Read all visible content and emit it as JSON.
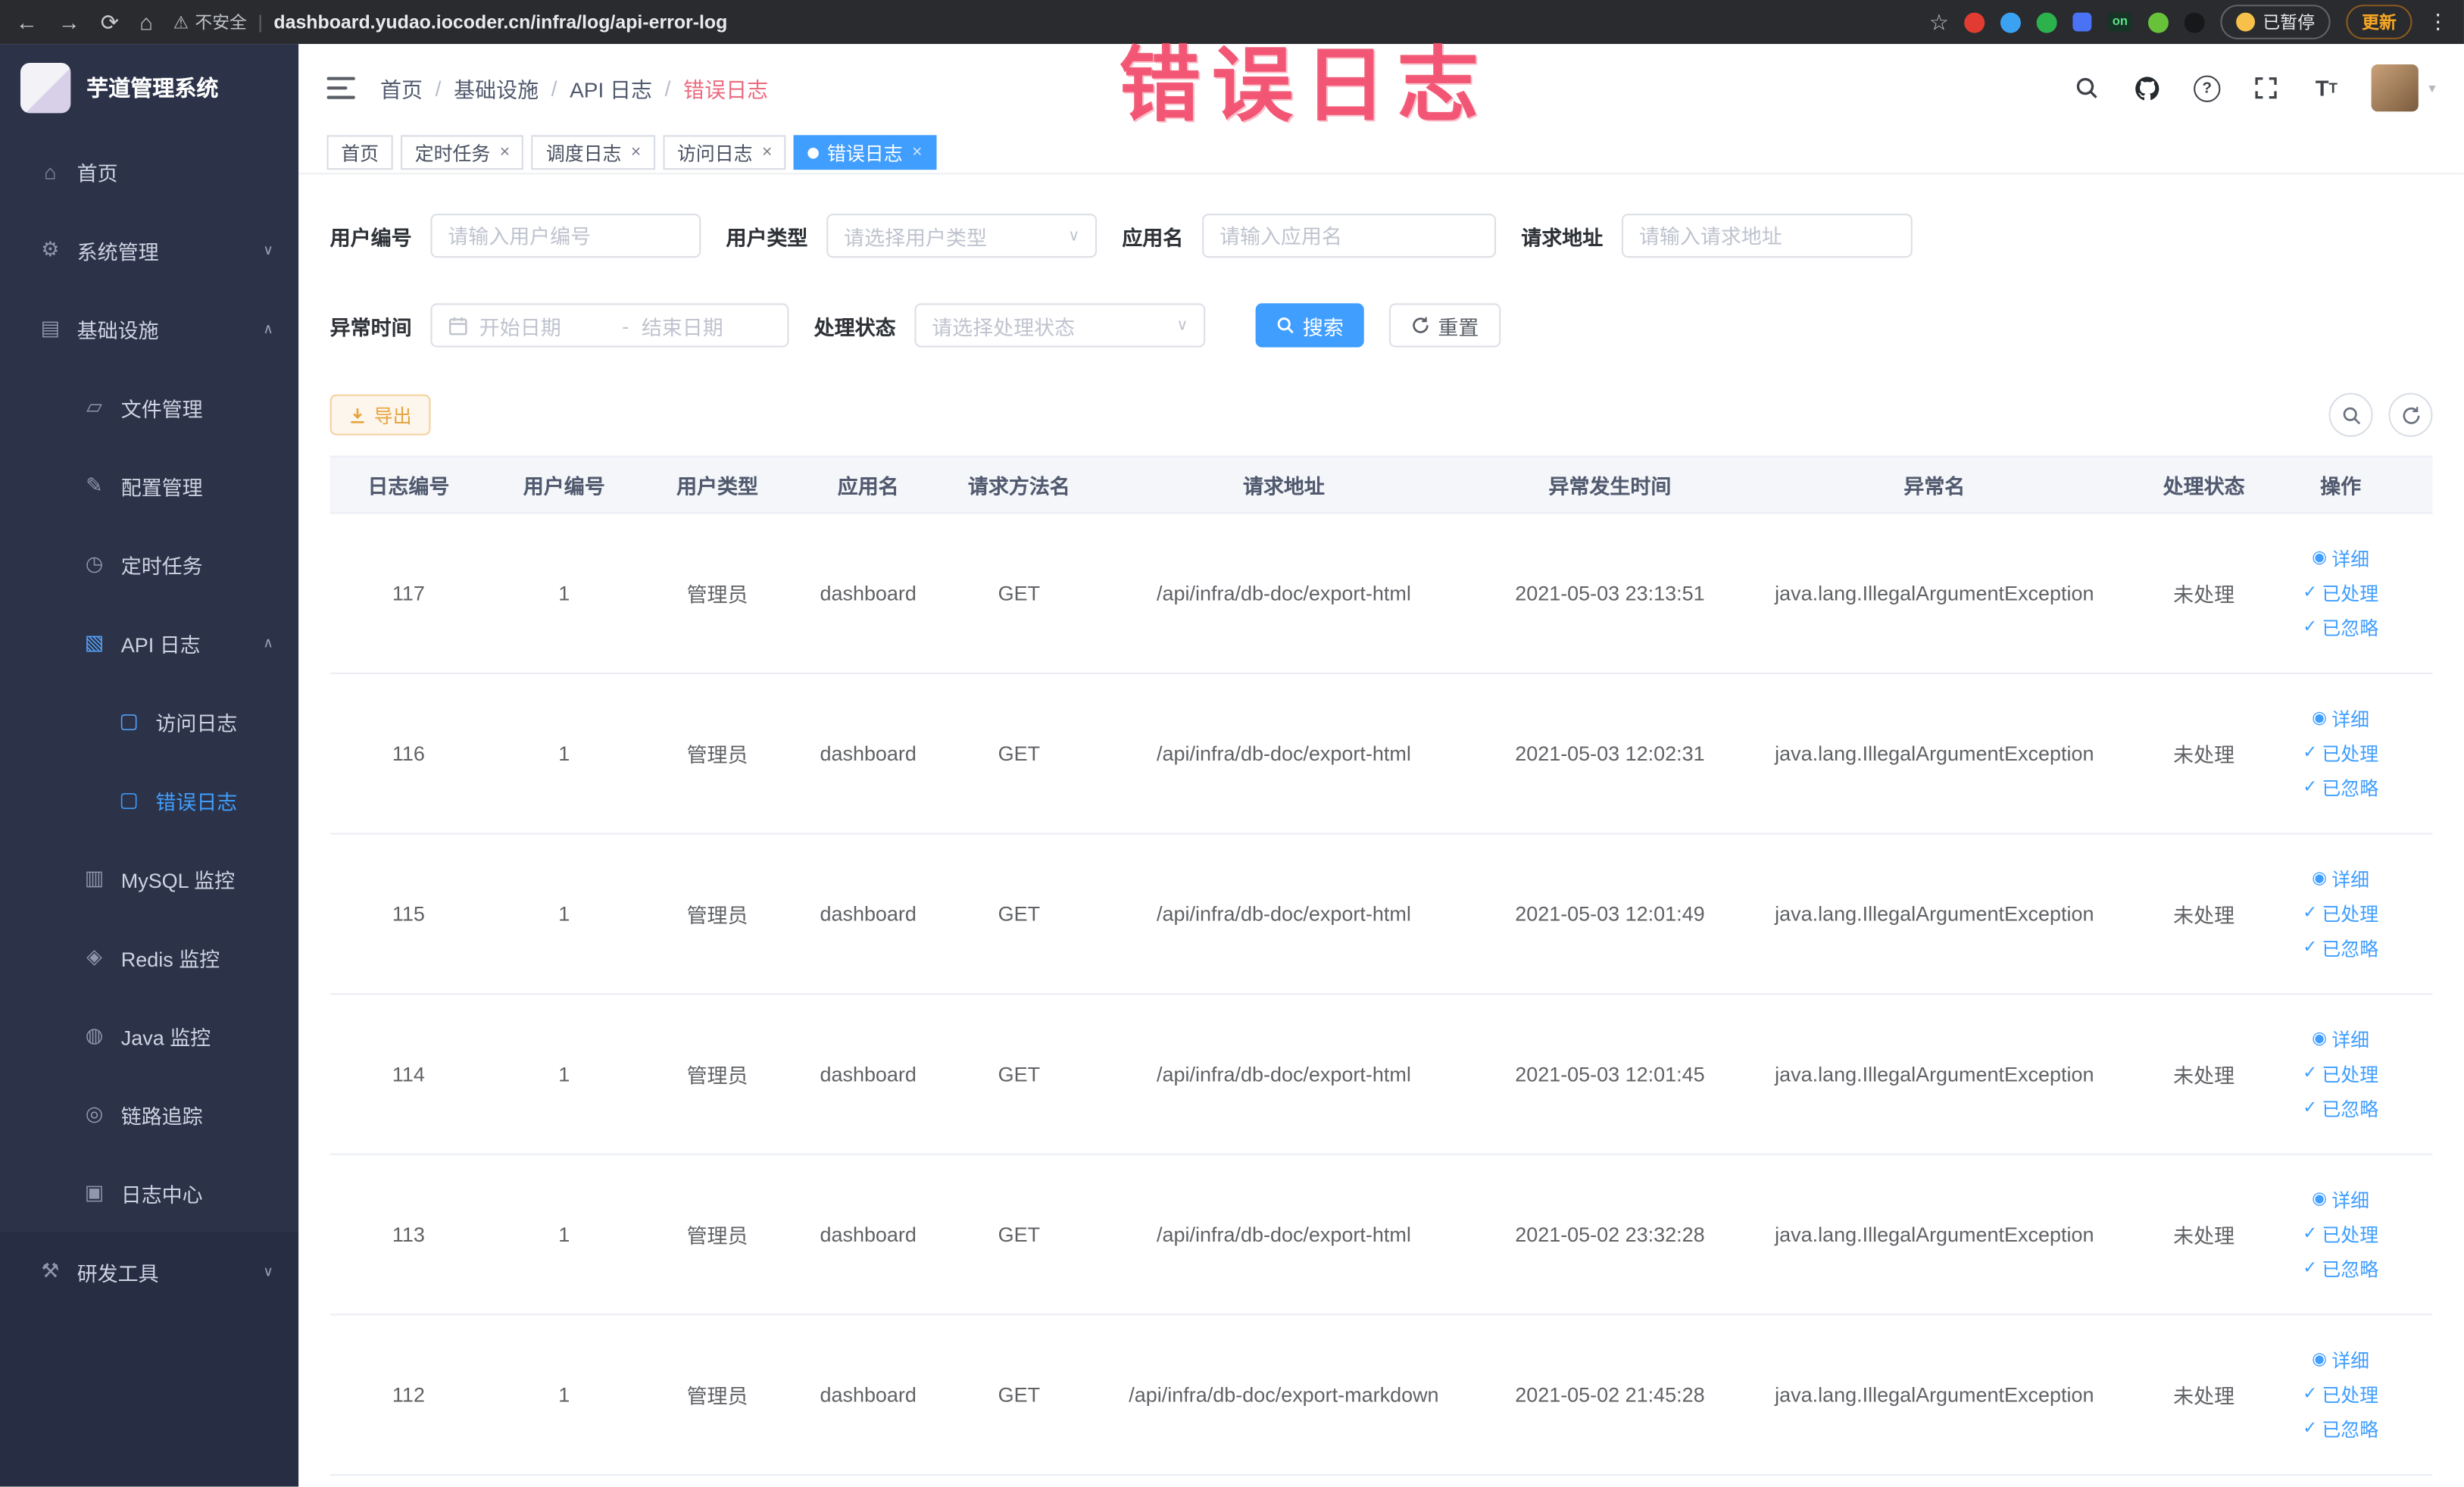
{
  "browser": {
    "security_label": "不安全",
    "url": "dashboard.yudao.iocoder.cn/infra/log/api-error-log",
    "paused_badge": "已暂停",
    "update_label": "更新",
    "on_badge": "on"
  },
  "annotation": {
    "text": "错误日志"
  },
  "sidebar": {
    "logo_title": "芋道管理系统",
    "items": [
      {
        "label": "首页",
        "icon": "home-icon",
        "level": 1
      },
      {
        "label": "系统管理",
        "icon": "gear-icon",
        "level": 1,
        "chevron": "down"
      },
      {
        "label": "基础设施",
        "icon": "infra-icon",
        "level": 1,
        "chevron": "up"
      },
      {
        "label": "文件管理",
        "icon": "file-icon",
        "level": 2
      },
      {
        "label": "配置管理",
        "icon": "config-icon",
        "level": 2
      },
      {
        "label": "定时任务",
        "icon": "timer-icon",
        "level": 2
      },
      {
        "label": "API 日志",
        "icon": "api-log-icon",
        "level": 2,
        "chevron": "up",
        "icon_blue": true
      },
      {
        "label": "访问日志",
        "icon": "doc-icon",
        "level": 3,
        "icon_blue": true
      },
      {
        "label": "错误日志",
        "icon": "doc-icon",
        "level": 3,
        "active": true
      },
      {
        "label": "MySQL 监控",
        "icon": "mysql-icon",
        "level": 2
      },
      {
        "label": "Redis 监控",
        "icon": "redis-icon",
        "level": 2
      },
      {
        "label": "Java 监控",
        "icon": "java-icon",
        "level": 2
      },
      {
        "label": "链路追踪",
        "icon": "trace-icon",
        "level": 2
      },
      {
        "label": "日志中心",
        "icon": "log-center-icon",
        "level": 2
      },
      {
        "label": "研发工具",
        "icon": "tools-icon",
        "level": 1,
        "chevron": "down",
        "section": "dark"
      }
    ]
  },
  "breadcrumb": [
    "首页",
    "基础设施",
    "API 日志",
    "错误日志"
  ],
  "tabs": [
    {
      "label": "首页",
      "closable": false,
      "active": false
    },
    {
      "label": "定时任务",
      "closable": true,
      "active": false
    },
    {
      "label": "调度日志",
      "closable": true,
      "active": false
    },
    {
      "label": "访问日志",
      "closable": true,
      "active": false
    },
    {
      "label": "错误日志",
      "closable": true,
      "active": true
    }
  ],
  "filters": {
    "user_id": {
      "label": "用户编号",
      "placeholder": "请输入用户编号"
    },
    "user_type": {
      "label": "用户类型",
      "placeholder": "请选择用户类型"
    },
    "app_name": {
      "label": "应用名",
      "placeholder": "请输入应用名"
    },
    "request_url": {
      "label": "请求地址",
      "placeholder": "请输入请求地址"
    },
    "exception_time": {
      "label": "异常时间",
      "start_placeholder": "开始日期",
      "separator": "-",
      "end_placeholder": "结束日期"
    },
    "process_status": {
      "label": "处理状态",
      "placeholder": "请选择处理状态"
    },
    "search_label": "搜索",
    "reset_label": "重置"
  },
  "toolbar": {
    "export_label": "导出"
  },
  "table": {
    "columns": [
      "日志编号",
      "用户编号",
      "用户类型",
      "应用名",
      "请求方法名",
      "请求地址",
      "异常发生时间",
      "异常名",
      "处理状态",
      "操作"
    ],
    "actions": [
      {
        "label": "详细"
      },
      {
        "label": "已处理"
      },
      {
        "label": "已忽略"
      }
    ],
    "rows": [
      {
        "log_id": "117",
        "user_id": "1",
        "user_type": "管理员",
        "app": "dashboard",
        "method": "GET",
        "url": "/api/infra/db-doc/export-html",
        "time": "2021-05-03 23:13:51",
        "exception": "java.lang.IllegalArgumentException",
        "status": "未处理"
      },
      {
        "log_id": "116",
        "user_id": "1",
        "user_type": "管理员",
        "app": "dashboard",
        "method": "GET",
        "url": "/api/infra/db-doc/export-html",
        "time": "2021-05-03 12:02:31",
        "exception": "java.lang.IllegalArgumentException",
        "status": "未处理"
      },
      {
        "log_id": "115",
        "user_id": "1",
        "user_type": "管理员",
        "app": "dashboard",
        "method": "GET",
        "url": "/api/infra/db-doc/export-html",
        "time": "2021-05-03 12:01:49",
        "exception": "java.lang.IllegalArgumentException",
        "status": "未处理"
      },
      {
        "log_id": "114",
        "user_id": "1",
        "user_type": "管理员",
        "app": "dashboard",
        "method": "GET",
        "url": "/api/infra/db-doc/export-html",
        "time": "2021-05-03 12:01:45",
        "exception": "java.lang.IllegalArgumentException",
        "status": "未处理"
      },
      {
        "log_id": "113",
        "user_id": "1",
        "user_type": "管理员",
        "app": "dashboard",
        "method": "GET",
        "url": "/api/infra/db-doc/export-html",
        "time": "2021-05-02 23:32:28",
        "exception": "java.lang.IllegalArgumentException",
        "status": "未处理"
      },
      {
        "log_id": "112",
        "user_id": "1",
        "user_type": "管理员",
        "app": "dashboard",
        "method": "GET",
        "url": "/api/infra/db-doc/export-markdown",
        "time": "2021-05-02 21:45:28",
        "exception": "java.lang.IllegalArgumentException",
        "status": "未处理"
      }
    ]
  }
}
